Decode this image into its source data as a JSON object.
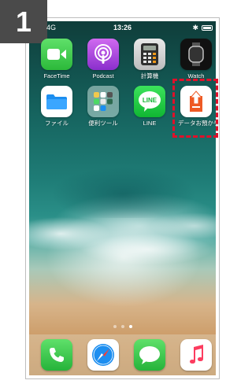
{
  "step": {
    "number": "1"
  },
  "status_bar": {
    "carrier": "4G",
    "time": "13:26",
    "bluetooth_icon": "bluetooth-icon",
    "battery_icon": "battery-icon"
  },
  "home_screen": {
    "row1": [
      {
        "label": "FaceTime",
        "icon": "facetime-icon"
      },
      {
        "label": "Podcast",
        "icon": "podcast-icon"
      },
      {
        "label": "計算機",
        "icon": "calculator-icon"
      },
      {
        "label": "Watch",
        "icon": "watch-icon"
      }
    ],
    "row2": [
      {
        "label": "ファイル",
        "icon": "files-icon"
      },
      {
        "label": "便利ツール",
        "icon": "folder-icon"
      },
      {
        "label": "LINE",
        "icon": "line-icon"
      },
      {
        "label": "データお預かり",
        "icon": "data-deposit-icon"
      }
    ],
    "line_icon_text": "LINE",
    "highlighted_app": "データお預かり",
    "highlight_color": "#e0102a"
  },
  "page_indicator": {
    "count": 3,
    "active_index": 2
  },
  "dock": [
    {
      "icon": "phone-icon"
    },
    {
      "icon": "safari-icon"
    },
    {
      "icon": "messages-icon"
    },
    {
      "icon": "music-icon"
    }
  ]
}
